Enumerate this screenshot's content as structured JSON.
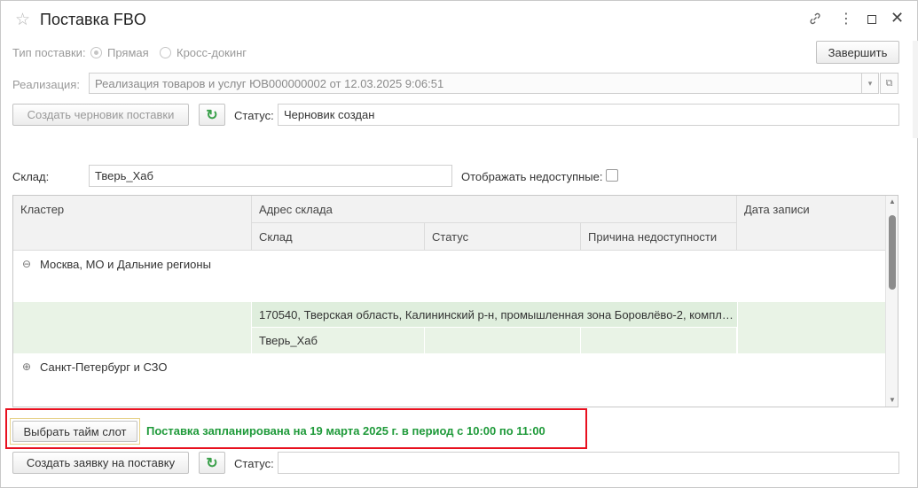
{
  "window": {
    "title": "Поставка FBO",
    "icons": {
      "favorite": "star-icon",
      "link": "link-icon",
      "more": "more-icon",
      "maximize": "maximize-icon",
      "close": "close-icon"
    }
  },
  "toolbar": {
    "finish_label": "Завершить"
  },
  "supply_type": {
    "label": "Тип поставки:",
    "options": [
      {
        "label": "Прямая",
        "selected": true
      },
      {
        "label": "Кросс-докинг",
        "selected": false
      }
    ]
  },
  "realization": {
    "label": "Реализация:",
    "value": "Реализация товаров и услуг ЮВ000000002 от 12.03.2025 9:06:51"
  },
  "draft": {
    "button_label": "Создать черновик поставки",
    "status_label": "Статус:",
    "status_value": "Черновик создан"
  },
  "warehouse_filter": {
    "label": "Склад:",
    "value": "Тверь_Хаб",
    "show_unavailable_label": "Отображать недоступные:",
    "show_unavailable": false
  },
  "table": {
    "headers": {
      "cluster": "Кластер",
      "address": "Адрес склада",
      "warehouse": "Склад",
      "status": "Статус",
      "reason": "Причина недоступности",
      "date": "Дата записи"
    },
    "groups": [
      {
        "toggle": "⊖",
        "name": "Москва, МО и Дальние регионы",
        "rows": [
          {
            "address": "170540, Тверская область, Калининский р-н, промышленная зона Боровлёво-2, компл…",
            "warehouse": "Тверь_Хаб",
            "status": "",
            "reason": "",
            "date": ""
          }
        ]
      },
      {
        "toggle": "⊕",
        "name": "Санкт-Петербург и СЗО",
        "rows": []
      }
    ]
  },
  "timeslot": {
    "button_label": "Выбрать тайм слот",
    "message": "Поставка запланирована на 19 марта 2025 г. в период с 10:00 по 11:00"
  },
  "request": {
    "button_label": "Создать заявку на поставку",
    "status_label": "Статус:",
    "status_value": ""
  },
  "colors": {
    "accent_green": "#1f9a3a",
    "highlight_red": "#e8101f",
    "selected_row": "#e9f3e6"
  }
}
